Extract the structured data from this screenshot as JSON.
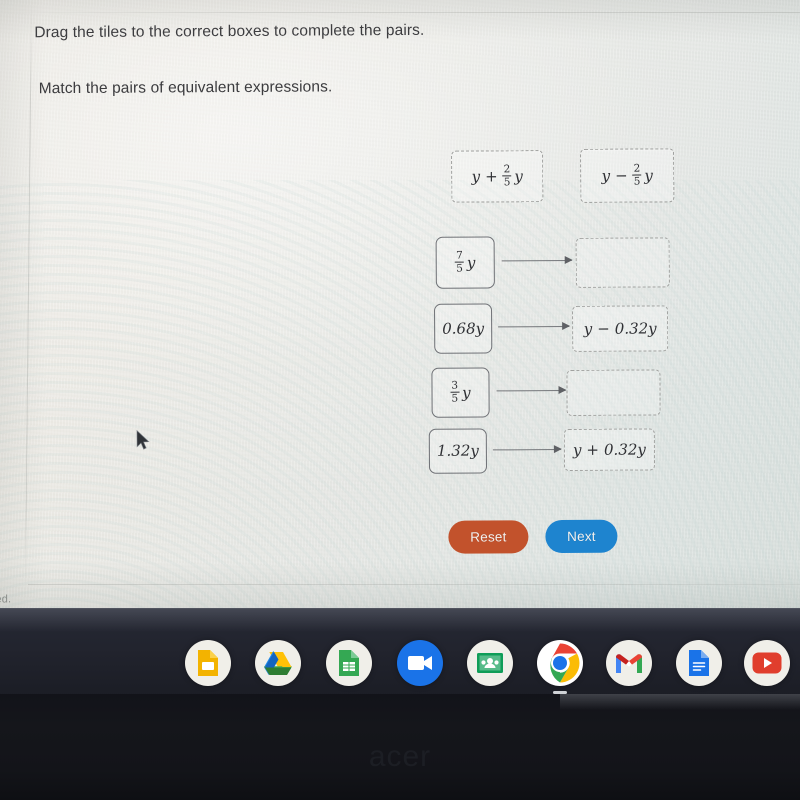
{
  "instructions": {
    "line1": "Drag the tiles to the correct boxes to complete the pairs.",
    "line2": "Match the pairs of equivalent expressions."
  },
  "exercise": {
    "top_tiles": [
      {
        "id": "tile-y-plus-2-5-y",
        "var": "y",
        "op": "+",
        "frac_num": "2",
        "frac_den": "5",
        "var2": "y"
      },
      {
        "id": "tile-y-minus-2-5-y",
        "var": "y",
        "op": "−",
        "frac_num": "2",
        "frac_den": "5",
        "var2": "y"
      }
    ],
    "rows": [
      {
        "source": {
          "kind": "fraction",
          "num": "7",
          "den": "5",
          "var": "y"
        },
        "target": {
          "filled": false,
          "var": "",
          "op": "",
          "value": "",
          "var2": ""
        }
      },
      {
        "source": {
          "kind": "decimal",
          "text": "0.68y"
        },
        "target": {
          "filled": true,
          "var": "y",
          "op": "−",
          "value": "0.32y",
          "var2": ""
        }
      },
      {
        "source": {
          "kind": "fraction",
          "num": "3",
          "den": "5",
          "var": "y"
        },
        "target": {
          "filled": false,
          "var": "",
          "op": "",
          "value": "",
          "var2": ""
        }
      },
      {
        "source": {
          "kind": "decimal",
          "text": "1.32y"
        },
        "target": {
          "filled": true,
          "var": "y",
          "op": "+",
          "value": "0.32y",
          "var2": ""
        }
      }
    ]
  },
  "buttons": {
    "reset": {
      "label": "Reset",
      "color": "#c2522c"
    },
    "next": {
      "label": "Next",
      "color": "#1e84cf"
    }
  },
  "footer": {
    "note": "rved."
  },
  "taskbar": {
    "icons": [
      {
        "name": "google-slides-icon",
        "label": "Slides"
      },
      {
        "name": "google-drive-icon",
        "label": "Drive"
      },
      {
        "name": "google-sheets-icon",
        "label": "Sheets"
      },
      {
        "name": "google-meet-icon",
        "label": "Meet"
      },
      {
        "name": "google-classroom-icon",
        "label": "Classroom"
      },
      {
        "name": "google-chrome-icon",
        "label": "Chrome"
      },
      {
        "name": "gmail-icon",
        "label": "Gmail"
      },
      {
        "name": "google-docs-icon",
        "label": "Docs"
      },
      {
        "name": "youtube-icon",
        "label": "YouTube"
      }
    ]
  },
  "device": {
    "brand": "acer"
  }
}
